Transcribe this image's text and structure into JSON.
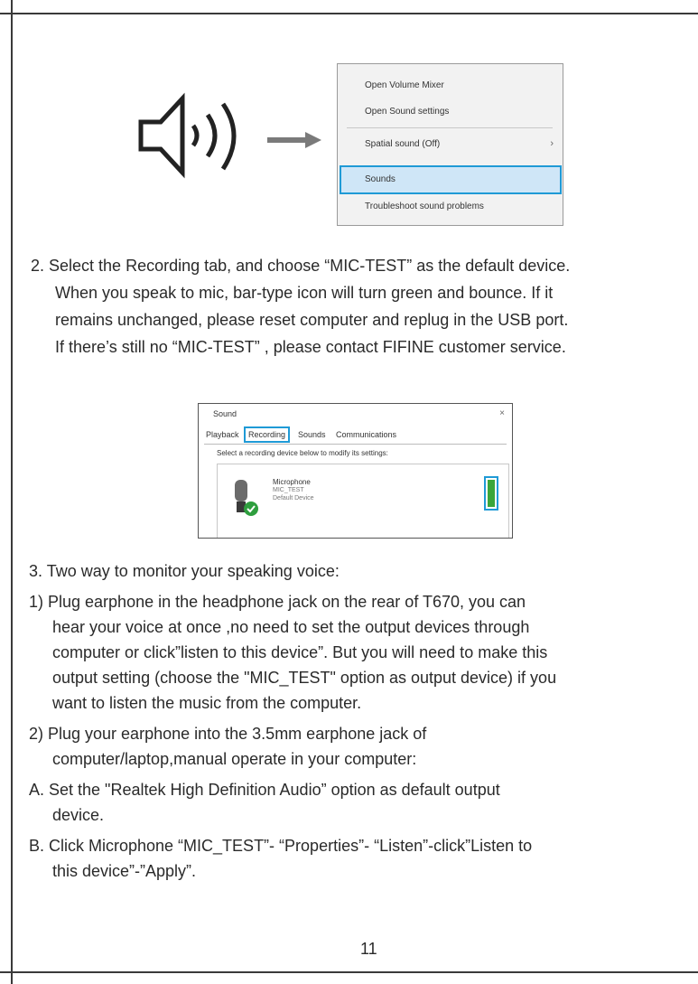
{
  "context_menu": {
    "items": [
      "Open Volume Mixer",
      "Open Sound settings",
      "Spatial sound (Off)",
      "Sounds",
      "Troubleshoot sound problems"
    ],
    "highlighted": "Sounds"
  },
  "step2": {
    "lines": [
      "2. Select the Recording tab, and choose “MIC-TEST” as the default device.",
      "When you speak to mic, bar-type icon will turn green and bounce. If it",
      "remains unchanged, please reset computer and replug in the USB port.",
      "If there’s still no “MIC-TEST” , please contact FIFINE customer service."
    ]
  },
  "sound_dialog": {
    "title": "Sound",
    "close": "×",
    "tabs": [
      "Playback",
      "Recording",
      "Sounds",
      "Communications"
    ],
    "active_tab": "Recording",
    "instruction": "Select a recording device below to modify its settings:",
    "device": {
      "name": "Microphone",
      "sub": "MIC_TEST",
      "status": "Default Device"
    },
    "level_color": "#3aa63a",
    "accent_color": "#1f9ad6"
  },
  "step3": {
    "heading": "3. Two way to monitor your speaking voice:",
    "item1": [
      "1) Plug earphone in the headphone jack on the rear of T670, you can",
      "hear your voice at once ,no need to set the output devices through",
      "computer or click”listen to this device”. But you will need to make this",
      "output setting (choose the \"MIC_TEST\" option as output device) if you",
      "want to listen the music from the computer."
    ],
    "item2": [
      "2) Plug your earphone into the 3.5mm earphone jack of",
      "computer/laptop,manual operate in your computer:"
    ],
    "itemA": [
      "A. Set the \"Realtek High Definition Audio” option as default output",
      "device."
    ],
    "itemB": [
      "B. Click Microphone “MIC_TEST”- “Properties”- “Listen”-click”Listen to",
      "this device”-”Apply”."
    ]
  },
  "page_number": "11"
}
